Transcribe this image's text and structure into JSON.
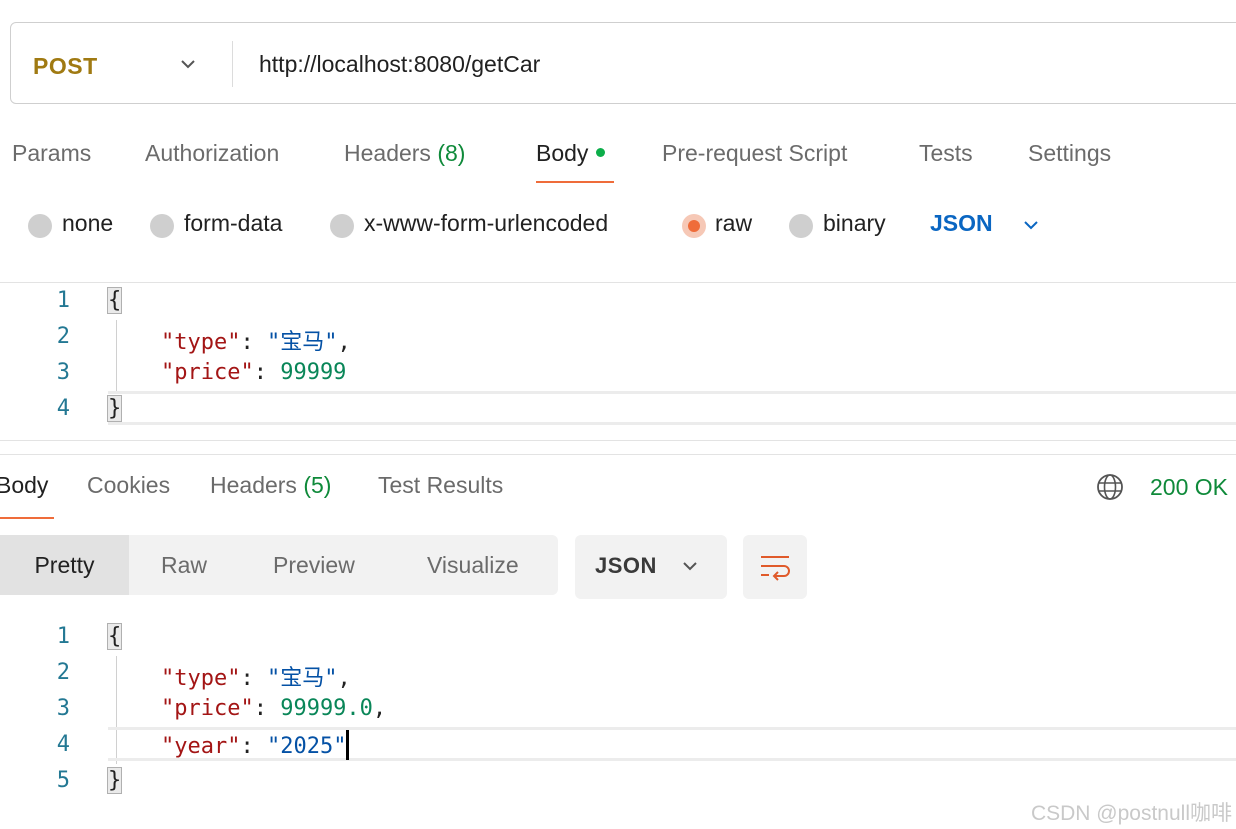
{
  "request": {
    "method": "POST",
    "url": "http://localhost:8080/getCar"
  },
  "request_tabs": {
    "params": "Params",
    "authorization": "Authorization",
    "headers": "Headers",
    "headers_count": "(8)",
    "body": "Body",
    "prerequest": "Pre-request Script",
    "tests": "Tests",
    "settings": "Settings"
  },
  "body_types": {
    "none": "none",
    "form_data": "form-data",
    "urlencoded": "x-www-form-urlencoded",
    "raw": "raw",
    "binary": "binary",
    "selected": "raw",
    "language": "JSON"
  },
  "request_body": {
    "line_numbers": [
      "1",
      "2",
      "3",
      "4"
    ],
    "open_brace": "{",
    "type_key": "\"type\"",
    "type_value": "\"宝马\"",
    "price_key": "\"price\"",
    "price_value": "99999",
    "close_brace": "}"
  },
  "response_tabs": {
    "body": "Body",
    "cookies": "Cookies",
    "headers": "Headers",
    "headers_count": "(5)",
    "test_results": "Test Results",
    "status": "200 OK"
  },
  "view_modes": {
    "pretty": "Pretty",
    "raw": "Raw",
    "preview": "Preview",
    "visualize": "Visualize",
    "format": "JSON"
  },
  "response_body": {
    "line_numbers": [
      "1",
      "2",
      "3",
      "4",
      "5"
    ],
    "open_brace": "{",
    "type_key": "\"type\"",
    "type_value": "\"宝马\"",
    "price_key": "\"price\"",
    "price_value": "99999.0",
    "year_key": "\"year\"",
    "year_value": "\"2025\"",
    "close_brace": "}"
  },
  "colors": {
    "accent": "#ef6c3a",
    "method": "#a07a12",
    "success": "#0f8a3a",
    "json_link": "#0a66c2",
    "json_key": "#a31515",
    "json_string": "#0451a5",
    "json_number": "#098658"
  },
  "watermark": "CSDN @postnull咖啡"
}
